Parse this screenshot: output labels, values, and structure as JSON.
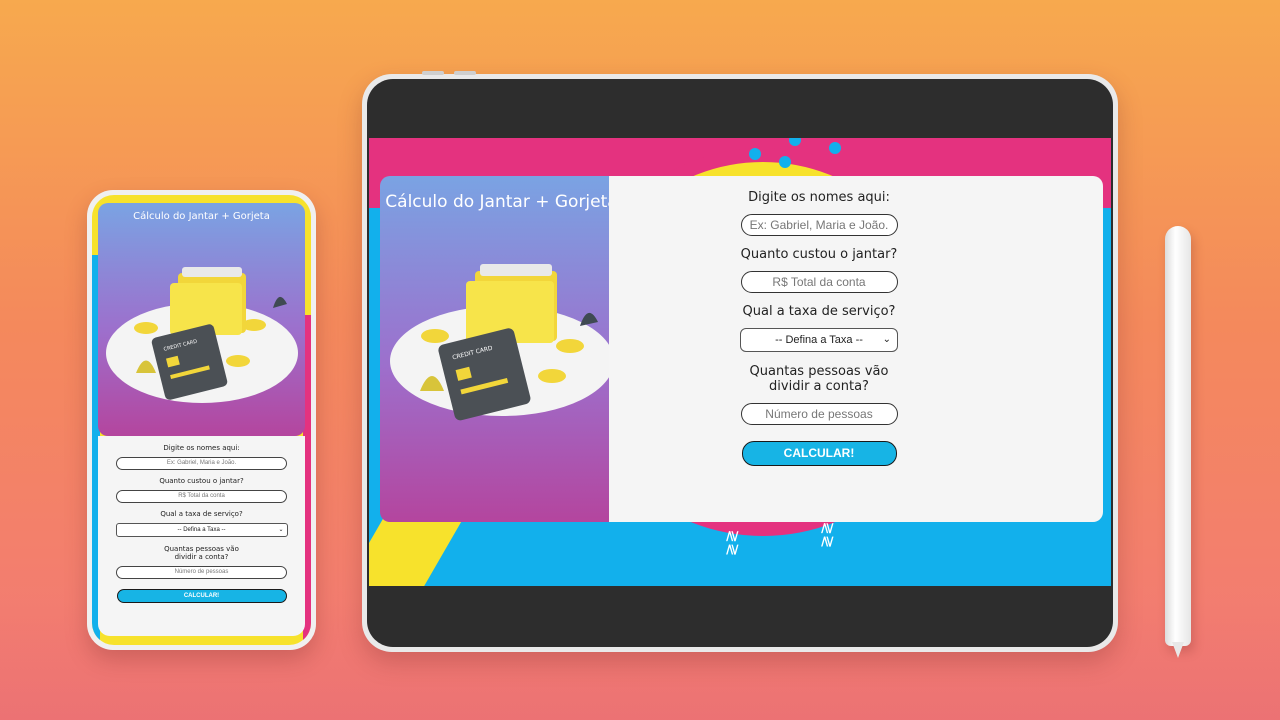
{
  "app": {
    "title": "Cálculo do Jantar + Gorjeta"
  },
  "form": {
    "names_label": "Digite os nomes aqui:",
    "names_placeholder": "Ex: Gabriel, Maria e João.",
    "bill_label": "Quanto custou o jantar?",
    "bill_placeholder": "R$ Total da conta",
    "tax_label": "Qual a taxa de serviço?",
    "tax_selected": "-- Defina a Taxa --",
    "people_label_line1": "Quantas pessoas vão",
    "people_label_line2": "dividir a conta?",
    "people_placeholder": "Número de pessoas",
    "submit_label": "CALCULAR!"
  },
  "illustration": {
    "card_text": "CREDIT CARD"
  },
  "colors": {
    "accent_button": "#17b4e5",
    "screen_pink": "#e4327f",
    "screen_blue": "#12b0ec",
    "screen_yellow": "#f7e22c",
    "card_gradient_top": "#7aa3e3",
    "card_gradient_bottom": "#b4459e"
  }
}
